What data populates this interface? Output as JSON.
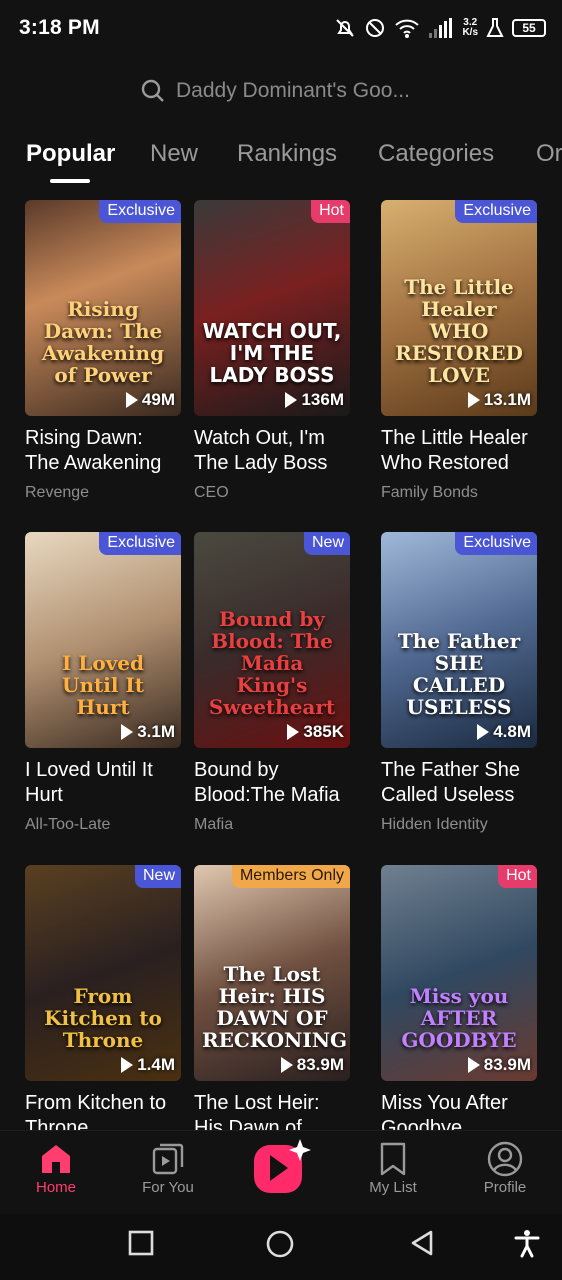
{
  "status": {
    "time": "3:18 PM",
    "net_speed_top": "3.2",
    "net_speed_bottom": "K/s",
    "battery": "55"
  },
  "search": {
    "placeholder": "Daddy Dominant's Goo..."
  },
  "tabs": [
    {
      "label": "Popular"
    },
    {
      "label": "New"
    },
    {
      "label": "Rankings"
    },
    {
      "label": "Categories"
    },
    {
      "label": "Or"
    }
  ],
  "cards": [
    {
      "badge": "Exclusive",
      "views": "49M",
      "poster_text": "Rising Dawn: The Awakening of Power",
      "title": "Rising Dawn: The Awakening of P...",
      "genre": "Revenge"
    },
    {
      "badge": "Hot",
      "views": "136M",
      "poster_text": "WATCH OUT, I'M THE LADY BOSS",
      "title": "Watch Out, I'm The Lady Boss",
      "genre": "CEO"
    },
    {
      "badge": "Exclusive",
      "views": "13.1M",
      "poster_text": "The Little Healer WHO RESTORED LOVE",
      "title": "The Little Healer Who Restored L...",
      "genre": "Family Bonds"
    },
    {
      "badge": "Exclusive",
      "views": "3.1M",
      "poster_text": "I Loved Until It Hurt",
      "title": "I Loved Until It Hurt",
      "genre": "All-Too-Late"
    },
    {
      "badge": "New",
      "views": "385K",
      "poster_text": "Bound by Blood: The Mafia King's Sweetheart",
      "title": "Bound by Blood:The Mafia ...",
      "genre": "Mafia"
    },
    {
      "badge": "Exclusive",
      "views": "4.8M",
      "poster_text": "The Father SHE CALLED USELESS",
      "title": "The Father She Called Useless",
      "genre": "Hidden Identity"
    },
    {
      "badge": "New",
      "views": "1.4M",
      "poster_text": "From Kitchen to Throne",
      "title": "From Kitchen to Throne",
      "genre": ""
    },
    {
      "badge": "Members Only",
      "views": "83.9M",
      "poster_text": "The Lost Heir: HIS DAWN OF RECKONING",
      "title": "The Lost Heir: His Dawn of Reckonin...",
      "genre": ""
    },
    {
      "badge": "Hot",
      "views": "83.9M",
      "poster_text": "Miss you AFTER GOODBYE",
      "title": "Miss You After Goodbye",
      "genre": ""
    }
  ],
  "nav": {
    "home": "Home",
    "for_you": "For You",
    "my_list": "My List",
    "profile": "Profile"
  },
  "colors": {
    "accent": "#ff3d6e",
    "badge_exclusive": "#4a56d6",
    "badge_hot": "#e63c6b",
    "badge_members": "#f0a84a"
  }
}
